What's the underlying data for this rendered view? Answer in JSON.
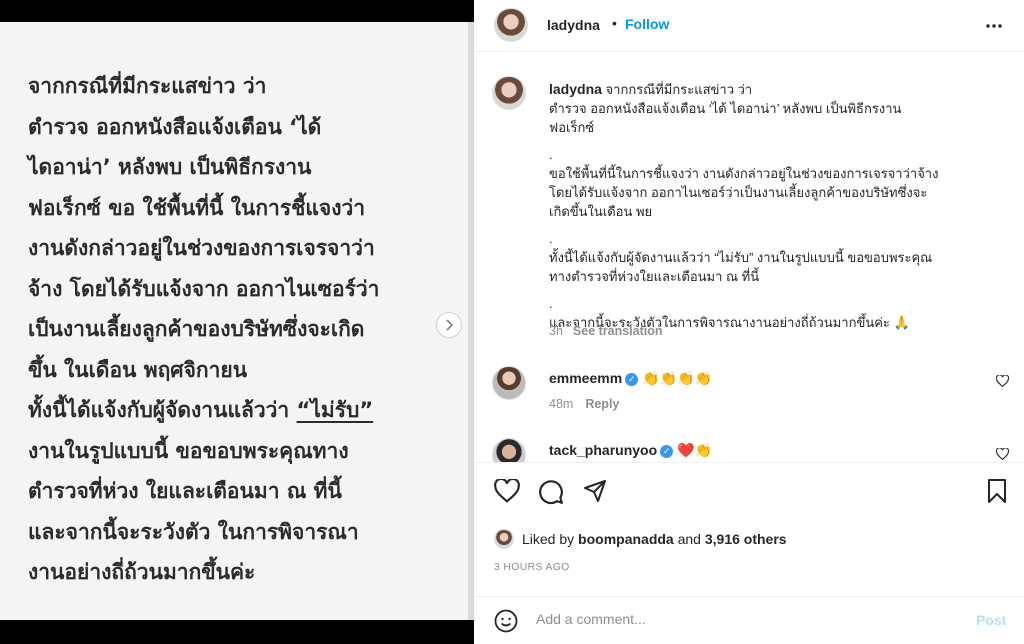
{
  "image": {
    "lines": [
      {
        "text": "จากกรณีที่มีกระแสข่าว ว่า"
      },
      {
        "text": "ตำรวจ ออกหนังสือแจ้งเตือน ‘ได้"
      },
      {
        "text": "ไดอาน่า’ หลังพบ เป็นพิธีกรงาน"
      },
      {
        "text": "ฟอเร็กซ์ ขอ ใช้พื้นที่นี้ ในการชี้แจงว่า"
      },
      {
        "text": "งานดังกล่าวอยู่ในช่วงของการเจรจาว่า"
      },
      {
        "text": "จ้าง โดยได้รับแจ้งจาก ออกาไนเซอร์ว่า"
      },
      {
        "text": "เป็นงานเลี้ยงลูกค้าของบริษัทซึ่งจะเกิด"
      },
      {
        "text": "ขึ้น ในเดือน พฤศจิกายน"
      },
      {
        "pre": "ทั้งนี้ได้แจ้งกับผู้จัดงานแล้วว่า ",
        "underlined": "“ไม่รับ”"
      },
      {
        "text": "งานในรูปแบบนี้ ขอขอบพระคุณทาง"
      },
      {
        "text": "ตำรวจที่ห่วง ใยและเตือนมา ณ ที่นี้"
      },
      {
        "text": "และจากนี้จะระวังตัว ในการพิจารณา"
      },
      {
        "text": "งานอย่างถี่ถ้วนมากขึ้นค่ะ"
      }
    ]
  },
  "header": {
    "username": "ladydna",
    "dot": "•",
    "follow_label": "Follow"
  },
  "caption": {
    "username": "ladydna",
    "lines": [
      "จากกรณีที่มีกระแสข่าว ว่า",
      "ตำรวจ ออกหนังสือแจ้งเตือน ‘ได้ ไดอาน่า’ หลังพบ เป็นพิธีกรงาน",
      "ฟอเร็กซ์",
      ".",
      "ขอใช้พื้นที่นี้ในการชี้แจงว่า งานดังกล่าวอยู่ในช่วงของการเจรจาว่าจ้าง",
      "โดยได้รับแจ้งจาก ออกาไนเซอร์ว่าเป็นงานเลี้ยงลูกค้าของบริษัทซึ่งจะ",
      "เกิดขึ้นในเดือน พย",
      ".",
      "ทั้งนี้ได้แจ้งกับผู้จัดงานแล้วว่า “ไม่รับ” งานในรูปแบบนี้ ขอขอบพระคุณ",
      "ทางตำรวจที่ห่วงใยและเตือนมา ณ ที่นี้",
      ".",
      "และจากนี้จะระวังตัวในการพิจารณางานอย่างถี่ถ้วนมากขึ้นค่ะ 🙏"
    ],
    "time": "3h",
    "see_translation": "See translation"
  },
  "comments": [
    {
      "username": "emmeemm",
      "verified": "✓",
      "text": "👏👏👏👏",
      "time": "48m",
      "reply_label": "Reply"
    },
    {
      "username": "tack_pharunyoo",
      "verified": "✓",
      "text": "❤️👏"
    }
  ],
  "likes": {
    "prefix": "Liked by",
    "user": "boompanadda",
    "and": "and",
    "others": "3,916 others"
  },
  "timestamp": "3 HOURS AGO",
  "add_comment": {
    "placeholder": "Add a comment...",
    "post_label": "Post"
  },
  "icons": {
    "more": "more-horizontal-icon",
    "like": "heart-icon",
    "comment": "comment-bubble-icon",
    "share": "paper-plane-icon",
    "save": "bookmark-icon",
    "emoji": "emoji-smile-icon",
    "next": "chevron-right-icon"
  },
  "colors": {
    "follow": "#0095f6",
    "post_disabled": "#b2dffc",
    "verified": "#3897f0",
    "meta_gray": "#8e8e8e"
  }
}
